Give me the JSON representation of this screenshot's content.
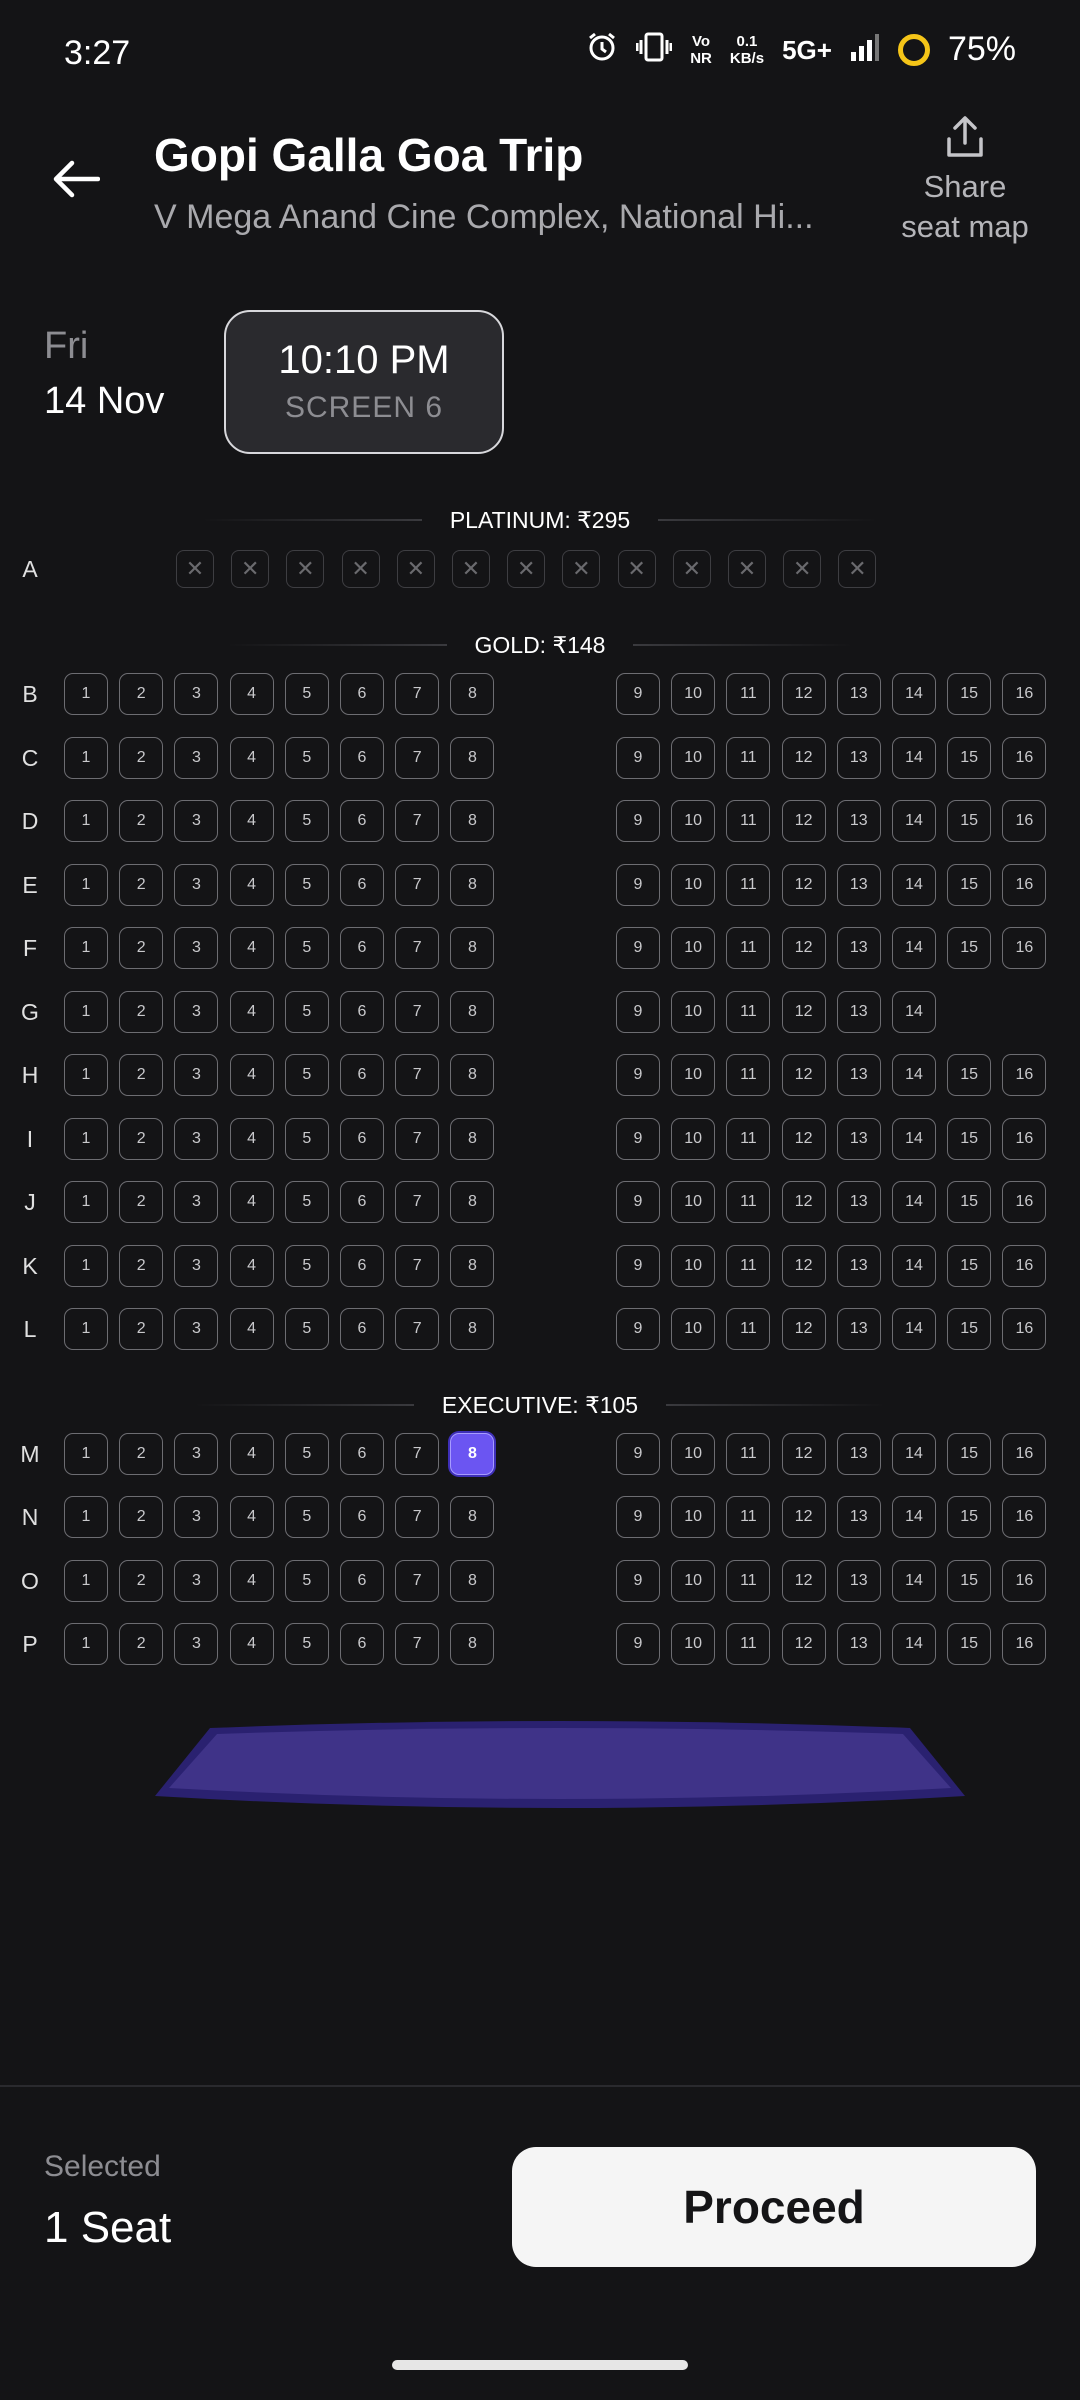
{
  "status_bar": {
    "time": "3:27",
    "net_speed_value": "0.1",
    "net_speed_unit": "KB/s",
    "network_type": "5G+",
    "volte_label_top": "Vo",
    "volte_label_bottom": "NR",
    "battery": "75%",
    "icons": [
      "alarm-icon",
      "vibrate-icon",
      "volte-icon",
      "signal-icon",
      "battery-ring-icon"
    ]
  },
  "header": {
    "title": "Gopi Galla Goa Trip",
    "venue": "V Mega Anand Cine Complex, National Hi...",
    "share_line1": "Share",
    "share_line2": "seat map"
  },
  "show": {
    "day": "Fri",
    "date": "14 Nov",
    "time": "10:10 PM",
    "screen": "SCREEN 6"
  },
  "seat_map": {
    "sections": [
      {
        "label": "PLATINUM: ₹295"
      },
      {
        "label": "GOLD: ₹148"
      },
      {
        "label": "EXECUTIVE: ₹105"
      }
    ],
    "sold_glyph": "✕",
    "rows": [
      {
        "label": "A",
        "section": 0,
        "sold_count": 13
      },
      {
        "label": "B",
        "section": 1,
        "seats": [
          1,
          2,
          3,
          4,
          5,
          6,
          7,
          8,
          9,
          10,
          11,
          12,
          13,
          14,
          15,
          16
        ]
      },
      {
        "label": "C",
        "section": 1,
        "seats": [
          1,
          2,
          3,
          4,
          5,
          6,
          7,
          8,
          9,
          10,
          11,
          12,
          13,
          14,
          15,
          16
        ]
      },
      {
        "label": "D",
        "section": 1,
        "seats": [
          1,
          2,
          3,
          4,
          5,
          6,
          7,
          8,
          9,
          10,
          11,
          12,
          13,
          14,
          15,
          16
        ]
      },
      {
        "label": "E",
        "section": 1,
        "seats": [
          1,
          2,
          3,
          4,
          5,
          6,
          7,
          8,
          9,
          10,
          11,
          12,
          13,
          14,
          15,
          16
        ]
      },
      {
        "label": "F",
        "section": 1,
        "seats": [
          1,
          2,
          3,
          4,
          5,
          6,
          7,
          8,
          9,
          10,
          11,
          12,
          13,
          14,
          15,
          16
        ]
      },
      {
        "label": "G",
        "section": 1,
        "seats": [
          1,
          2,
          3,
          4,
          5,
          6,
          7,
          8,
          9,
          10,
          11,
          12,
          13,
          14
        ]
      },
      {
        "label": "H",
        "section": 1,
        "seats": [
          1,
          2,
          3,
          4,
          5,
          6,
          7,
          8,
          9,
          10,
          11,
          12,
          13,
          14,
          15,
          16
        ]
      },
      {
        "label": "I",
        "section": 1,
        "seats": [
          1,
          2,
          3,
          4,
          5,
          6,
          7,
          8,
          9,
          10,
          11,
          12,
          13,
          14,
          15,
          16
        ]
      },
      {
        "label": "J",
        "section": 1,
        "seats": [
          1,
          2,
          3,
          4,
          5,
          6,
          7,
          8,
          9,
          10,
          11,
          12,
          13,
          14,
          15,
          16
        ]
      },
      {
        "label": "K",
        "section": 1,
        "seats": [
          1,
          2,
          3,
          4,
          5,
          6,
          7,
          8,
          9,
          10,
          11,
          12,
          13,
          14,
          15,
          16
        ]
      },
      {
        "label": "L",
        "section": 1,
        "seats": [
          1,
          2,
          3,
          4,
          5,
          6,
          7,
          8,
          9,
          10,
          11,
          12,
          13,
          14,
          15,
          16
        ]
      },
      {
        "label": "M",
        "section": 2,
        "seats": [
          1,
          2,
          3,
          4,
          5,
          6,
          7,
          8,
          9,
          10,
          11,
          12,
          13,
          14,
          15,
          16
        ],
        "selected": [
          8
        ]
      },
      {
        "label": "N",
        "section": 2,
        "seats": [
          1,
          2,
          3,
          4,
          5,
          6,
          7,
          8,
          9,
          10,
          11,
          12,
          13,
          14,
          15,
          16
        ]
      },
      {
        "label": "O",
        "section": 2,
        "seats": [
          1,
          2,
          3,
          4,
          5,
          6,
          7,
          8,
          9,
          10,
          11,
          12,
          13,
          14,
          15,
          16
        ]
      },
      {
        "label": "P",
        "section": 2,
        "seats": [
          1,
          2,
          3,
          4,
          5,
          6,
          7,
          8,
          9,
          10,
          11,
          12,
          13,
          14,
          15,
          16
        ]
      }
    ]
  },
  "colors": {
    "background": "#141416",
    "selected_seat": "#6b55f2",
    "screen": "#3f3388",
    "screen_edge": "#2a2170"
  },
  "footer": {
    "selected_label": "Selected",
    "selected_count": "1 Seat",
    "proceed_label": "Proceed"
  }
}
